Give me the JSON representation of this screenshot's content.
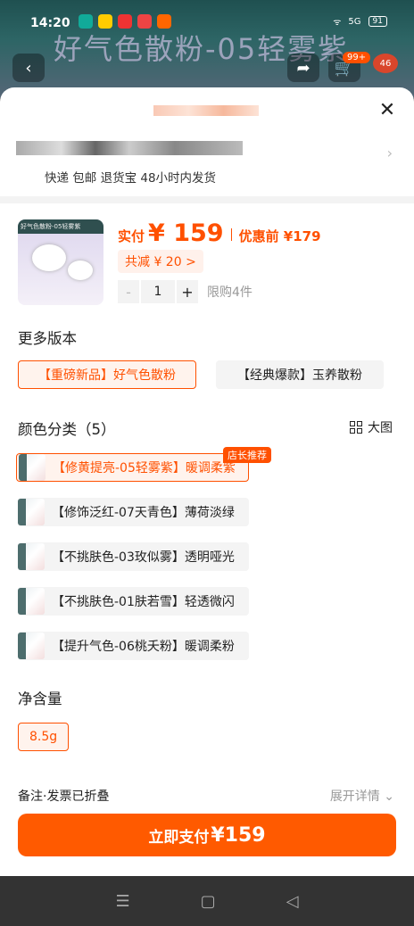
{
  "status_bar": {
    "time": "14:20",
    "battery": "91",
    "signal": "5G"
  },
  "background": {
    "product_title": "好气色散粉-05轻雾紫",
    "cart_badge": "99+",
    "badge2": "46"
  },
  "sheet": {
    "close_icon": "close-icon",
    "address_line": "快递 包邮 退货宝 48小时内发货"
  },
  "product": {
    "price_label": "实付",
    "price_amount": "¥ 159",
    "pre_label": "优惠前 ¥179",
    "discount": "共减 ¥ 20 >",
    "quantity": "1",
    "minus": "-",
    "plus": "+",
    "limit": "限购4件"
  },
  "versions": {
    "title": "更多版本",
    "options": [
      {
        "label": "【重磅新品】好气色散粉",
        "selected": true
      },
      {
        "label": "【经典爆款】玉养散粉",
        "selected": false
      }
    ]
  },
  "colors": {
    "title": "颜色分类（5）",
    "big_image_label": "大图",
    "recommend_badge": "店长推荐",
    "options": [
      {
        "label": "【修黄提亮-05轻雾紫】暖调柔紫",
        "selected": true
      },
      {
        "label": "【修饰泛红-07天青色】薄荷淡绿",
        "selected": false
      },
      {
        "label": "【不挑肤色-03玫似雾】透明哑光",
        "selected": false
      },
      {
        "label": "【不挑肤色-01肤若雪】轻透微闪",
        "selected": false
      },
      {
        "label": "【提升气色-06桃夭粉】暖调柔粉",
        "selected": false
      }
    ]
  },
  "net_content": {
    "title": "净含量",
    "options": [
      {
        "label": "8.5g",
        "selected": true
      }
    ]
  },
  "footer": {
    "note": "备注·发票已折叠",
    "expand": "展开详情 ⌄",
    "pay_label": "立即支付",
    "pay_amount": "¥159"
  },
  "navbar": {
    "menu": "☰",
    "home": "▢",
    "back": "◁"
  },
  "colors_theme": {
    "accent": "#ff5000"
  }
}
